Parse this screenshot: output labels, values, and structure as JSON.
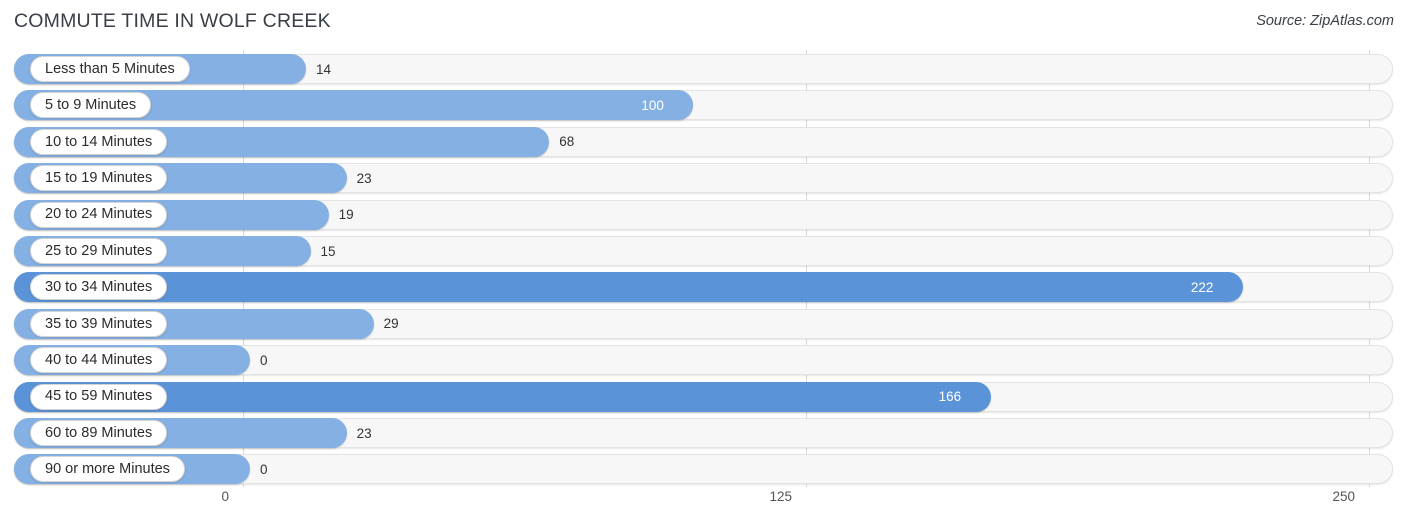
{
  "header": {
    "title": "COMMUTE TIME IN WOLF CREEK",
    "source": "Source: ZipAtlas.com"
  },
  "colors": {
    "bar_normal": "#85b0e3",
    "bar_accent": "#5b93d8",
    "track": "#f7f7f7",
    "gridline": "#d9d9d9",
    "title_text": "#3a3f47"
  },
  "chart_data": {
    "type": "bar",
    "orientation": "horizontal",
    "title": "COMMUTE TIME IN WOLF CREEK",
    "subtitle": "",
    "xlabel": "",
    "ylabel": "",
    "xlim": [
      0,
      250
    ],
    "grid": true,
    "legend": null,
    "xticks": [
      "0",
      "125",
      "250"
    ],
    "xtick_values": [
      0,
      125,
      250
    ],
    "categories": [
      "Less than 5 Minutes",
      "5 to 9 Minutes",
      "10 to 14 Minutes",
      "15 to 19 Minutes",
      "20 to 24 Minutes",
      "25 to 29 Minutes",
      "30 to 34 Minutes",
      "35 to 39 Minutes",
      "40 to 44 Minutes",
      "45 to 59 Minutes",
      "60 to 89 Minutes",
      "90 or more Minutes"
    ],
    "values": [
      14,
      100,
      68,
      23,
      19,
      15,
      222,
      29,
      0,
      166,
      23,
      0
    ],
    "value_labels": [
      "14",
      "100",
      "68",
      "23",
      "19",
      "15",
      "222",
      "29",
      "0",
      "166",
      "23",
      "0"
    ],
    "highlighted": [
      false,
      false,
      false,
      false,
      false,
      false,
      true,
      false,
      false,
      true,
      false,
      false
    ]
  }
}
